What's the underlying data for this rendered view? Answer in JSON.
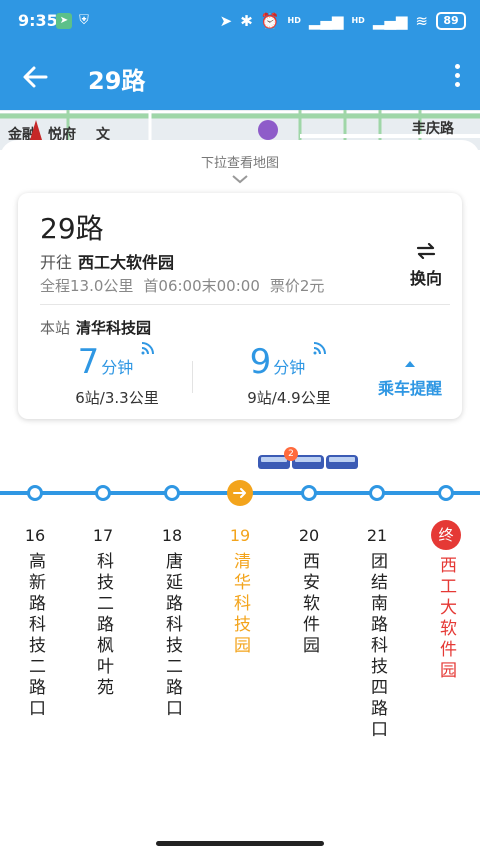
{
  "status": {
    "time": "9:35",
    "hd1": "HD",
    "hd2": "HD",
    "battery": "89"
  },
  "header": {
    "title": "29路"
  },
  "map": {
    "labels": [
      "金融",
      "悦府",
      "文",
      "丰庆路"
    ]
  },
  "sheet": {
    "pull_hint": "下拉查看地图"
  },
  "card": {
    "route_name": "29路",
    "direction_prefix": "开往",
    "direction_dest": "西工大软件园",
    "distance": "全程13.0公里",
    "first_last": "首06:00末00:00",
    "fare": "票价2元",
    "switch_label": "换向",
    "stop_prefix": "本站",
    "stop_name": "清华科技园",
    "eta": [
      {
        "num": "7",
        "unit": "分钟",
        "dist": "6站/3.3公里"
      },
      {
        "num": "9",
        "unit": "分钟",
        "dist": "9站/4.9公里"
      }
    ],
    "remind_label": "乘车提醒"
  },
  "buses": {
    "badge": "2"
  },
  "stops": [
    {
      "num": "16",
      "name": "高新路科技二路口"
    },
    {
      "num": "17",
      "name": "科技二路枫叶苑"
    },
    {
      "num": "18",
      "name": "唐延路科技二路口"
    },
    {
      "num": "19",
      "name": "清华科技园"
    },
    {
      "num": "20",
      "name": "西安软件园"
    },
    {
      "num": "21",
      "name": "团结南路科技四路口"
    },
    {
      "num": "终",
      "name": "西工大软件园"
    }
  ],
  "colors": {
    "primary": "#2f97e3",
    "current": "#f3a41c",
    "terminal": "#e53935"
  }
}
